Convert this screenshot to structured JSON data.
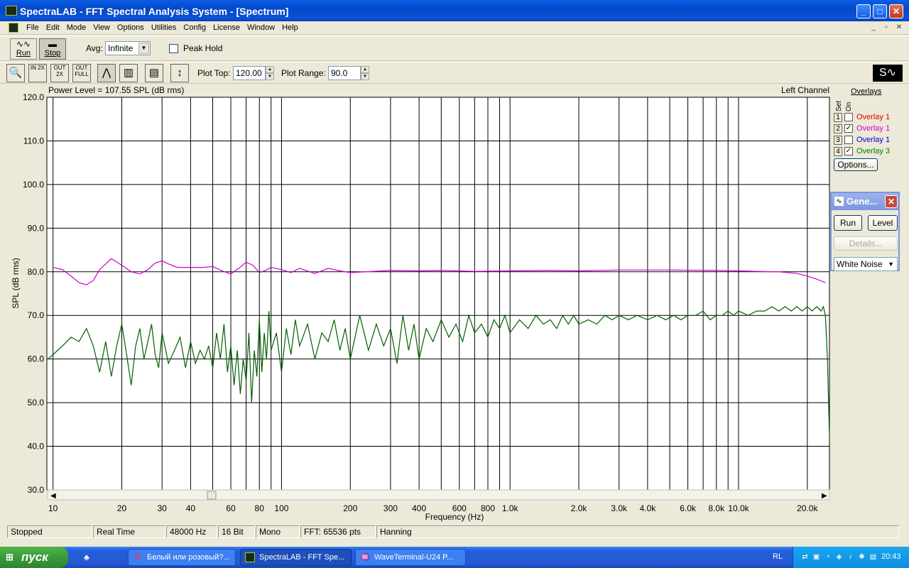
{
  "window": {
    "title": "SpectraLAB - FFT Spectral Analysis System - [Spectrum]",
    "buttons": {
      "minimize": "_",
      "maximize": "□",
      "close": "✕"
    }
  },
  "menu": {
    "items": [
      "File",
      "Edit",
      "Mode",
      "View",
      "Options",
      "Utilities",
      "Config",
      "License",
      "Window",
      "Help"
    ],
    "mdi_controls": [
      "_",
      "▫",
      "✕"
    ]
  },
  "toolbar1": {
    "run_label": "Run",
    "stop_label": "Stop",
    "avg_label": "Avg:",
    "avg_value": "Infinite",
    "peak_hold_label": "Peak Hold",
    "peak_hold_checked": false
  },
  "toolbar2": {
    "tools": [
      {
        "name": "zoom-icon",
        "text": "🔍"
      },
      {
        "name": "zoom-in-2x-icon",
        "text": "IN 2X"
      },
      {
        "name": "zoom-out-2x-icon",
        "text": "OUT 2X"
      },
      {
        "name": "zoom-out-full-icon",
        "text": "OUT FULL"
      },
      {
        "name": "line-plot-icon",
        "text": "⋀"
      },
      {
        "name": "bar-plot-icon",
        "text": "▥"
      },
      {
        "name": "table-view-icon",
        "text": "▤"
      },
      {
        "name": "autoscale-icon",
        "text": "↕"
      }
    ],
    "plot_top_label": "Plot Top:",
    "plot_top_value": "120.00",
    "plot_range_label": "Plot Range:",
    "plot_range_value": "90.0"
  },
  "plot": {
    "power_level": "Power Level = 107.55 SPL (dB rms)",
    "channel": "Left Channel",
    "ylabel": "SPL (dB rms)",
    "xlabel": "Frequency (Hz)"
  },
  "overlays": {
    "title": "Overlays",
    "col_set": "Set",
    "col_on": "On",
    "rows": [
      {
        "num": "1",
        "checked": false,
        "name": "Overlay 1",
        "color": "#e00000"
      },
      {
        "num": "2",
        "checked": true,
        "name": "Overlay 1",
        "color": "#d000d0"
      },
      {
        "num": "3",
        "checked": false,
        "name": "Overlay 1",
        "color": "#0000d0"
      },
      {
        "num": "4",
        "checked": true,
        "name": "Overlay 3",
        "color": "#008000"
      }
    ],
    "options_label": "Options..."
  },
  "generator": {
    "title": "Gene...",
    "run_label": "Run",
    "level_label": "Level",
    "details_label": "Details...",
    "signal_value": "White Noise"
  },
  "statusbar": {
    "cells": [
      "Stopped",
      "Real Time",
      "48000 Hz",
      "16 Bit",
      "Mono",
      "FFT: 65536 pts",
      "Hanning"
    ]
  },
  "taskbar": {
    "start_label": "пуск",
    "buttons": [
      {
        "label": "Белый или розовый?...",
        "active": false
      },
      {
        "label": "SpectraLAB - FFT Spe...",
        "active": true
      },
      {
        "label": "WaveTerminal-U24 P...",
        "active": false
      }
    ],
    "lang": "RL",
    "clock": "20:43"
  },
  "chart_data": {
    "type": "line",
    "title": "",
    "xlabel": "Frequency (Hz)",
    "ylabel": "SPL (dB rms)",
    "xscale": "log",
    "xlim": [
      9.4,
      25000
    ],
    "ylim": [
      30,
      120
    ],
    "grid": true,
    "yticks": [
      "30.0",
      "40.0",
      "50.0",
      "60.0",
      "70.0",
      "80.0",
      "90.0",
      "100.0",
      "110.0",
      "120.0"
    ],
    "xticks": [
      {
        "v": 10,
        "label": "10"
      },
      {
        "v": 20,
        "label": "20"
      },
      {
        "v": 30,
        "label": "30"
      },
      {
        "v": 40,
        "label": "40"
      },
      {
        "v": 60,
        "label": "60"
      },
      {
        "v": 80,
        "label": "80"
      },
      {
        "v": 100,
        "label": "100"
      },
      {
        "v": 200,
        "label": "200"
      },
      {
        "v": 300,
        "label": "300"
      },
      {
        "v": 400,
        "label": "400"
      },
      {
        "v": 600,
        "label": "600"
      },
      {
        "v": 800,
        "label": "800"
      },
      {
        "v": 1000,
        "label": "1.0k"
      },
      {
        "v": 2000,
        "label": "2.0k"
      },
      {
        "v": 3000,
        "label": "3.0k"
      },
      {
        "v": 4000,
        "label": "4.0k"
      },
      {
        "v": 6000,
        "label": "6.0k"
      },
      {
        "v": 8000,
        "label": "8.0k"
      },
      {
        "v": 10000,
        "label": "10.0k"
      },
      {
        "v": 20000,
        "label": "20.0k"
      }
    ],
    "series": [
      {
        "color": "#d000d0",
        "x": [
          10,
          11,
          12,
          13,
          14,
          15,
          16,
          18,
          20,
          22,
          24,
          26,
          28,
          30,
          32,
          35,
          40,
          45,
          50,
          55,
          60,
          65,
          70,
          75,
          80,
          85,
          90,
          100,
          110,
          120,
          140,
          160,
          180,
          200,
          250,
          300,
          400,
          500,
          700,
          1000,
          1500,
          2000,
          3000,
          5000,
          8000,
          10000,
          12000,
          15000,
          18000,
          20000,
          22000,
          24000
        ],
        "y": [
          81,
          80.5,
          79,
          77.5,
          77,
          78,
          80.5,
          83,
          81.5,
          80,
          79.5,
          80.5,
          82,
          82.5,
          81.8,
          81,
          81,
          81,
          81.2,
          80.2,
          79.5,
          80.8,
          82.2,
          81.5,
          79.8,
          80.3,
          81,
          80.5,
          79.8,
          80.8,
          79.6,
          80.8,
          80.2,
          79.8,
          80.1,
          80.3,
          80.2,
          80.3,
          80.1,
          80.2,
          80.3,
          80.2,
          80.4,
          80.4,
          80.3,
          80.2,
          80.1,
          80,
          79.6,
          79,
          78.3,
          77.5
        ]
      },
      {
        "color": "#006000",
        "x": [
          9.5,
          10,
          11,
          12,
          13,
          14,
          15,
          16,
          17,
          18,
          19,
          20,
          21,
          22,
          23,
          24,
          25,
          26,
          27,
          28,
          29,
          30,
          32,
          34,
          36,
          38,
          40,
          42,
          44,
          46,
          48,
          50,
          52,
          54,
          56,
          58,
          60,
          62,
          64,
          66,
          68,
          70,
          72,
          74,
          76,
          78,
          80,
          82,
          84,
          86,
          88,
          90,
          95,
          100,
          105,
          110,
          115,
          120,
          130,
          140,
          150,
          160,
          170,
          180,
          190,
          200,
          220,
          240,
          260,
          280,
          300,
          320,
          340,
          360,
          380,
          400,
          430,
          460,
          500,
          540,
          580,
          620,
          660,
          700,
          750,
          800,
          850,
          900,
          950,
          1000,
          1100,
          1200,
          1300,
          1400,
          1500,
          1600,
          1700,
          1800,
          1900,
          2000,
          2200,
          2400,
          2600,
          2800,
          3000,
          3300,
          3600,
          4000,
          4400,
          4800,
          5200,
          5600,
          6000,
          6500,
          7000,
          7500,
          8000,
          8500,
          9000,
          9500,
          10000,
          11000,
          12000,
          13000,
          14000,
          15000,
          16000,
          17000,
          18000,
          19000,
          20000,
          21000,
          22000,
          23000,
          23500,
          24000,
          24500,
          25000
        ],
        "y": [
          60,
          61,
          63,
          65,
          64,
          67,
          63,
          57,
          64,
          56,
          63,
          68,
          61,
          54,
          63,
          67,
          60,
          64,
          68,
          61,
          58,
          66,
          59,
          62,
          65,
          58,
          64,
          59,
          62,
          60,
          63,
          58,
          66,
          60,
          68,
          57,
          63,
          54,
          62,
          52,
          60,
          55,
          66,
          50,
          62,
          56,
          69,
          57,
          66,
          60,
          71,
          62,
          66,
          57,
          67,
          61,
          69,
          63,
          68,
          60,
          66,
          64,
          69,
          62,
          67,
          60,
          70,
          62,
          68,
          63,
          67,
          59,
          70,
          62,
          68,
          60,
          67,
          64,
          69,
          65,
          68,
          64,
          70,
          66,
          68,
          65,
          69,
          67,
          70,
          66,
          69,
          67,
          70,
          68,
          69,
          67,
          70,
          68,
          70,
          68,
          69,
          68,
          70,
          69,
          70,
          69,
          70,
          69,
          70,
          69,
          70,
          69,
          70,
          70,
          71,
          69,
          70,
          70,
          71,
          70,
          71,
          70,
          71,
          71,
          72,
          71,
          72,
          71,
          72,
          71,
          72,
          71,
          72,
          71,
          72,
          70,
          60,
          42
        ]
      }
    ]
  }
}
